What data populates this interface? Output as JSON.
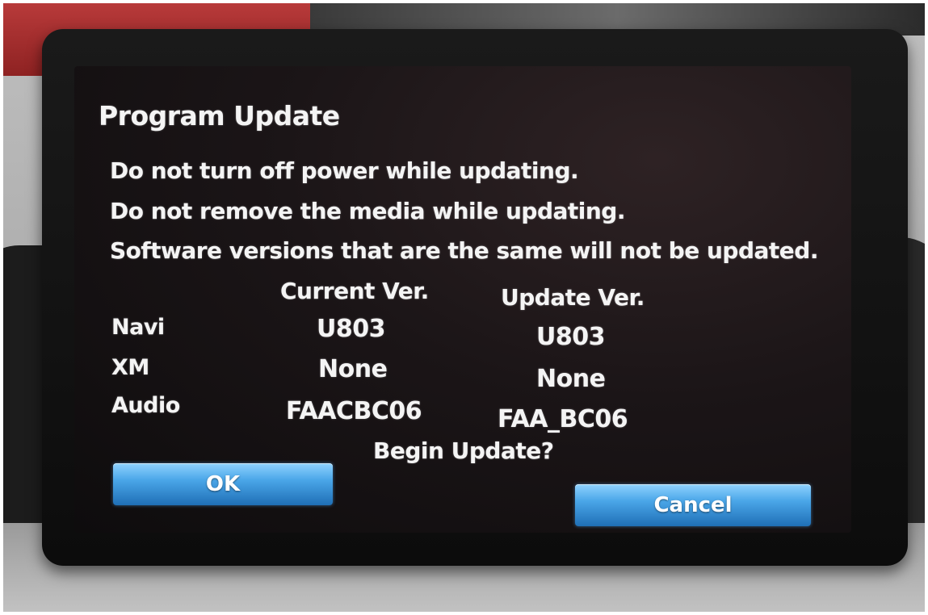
{
  "screen": {
    "title": "Program Update",
    "messages": [
      "Do not turn off power while updating.",
      "Do not remove the media while updating.",
      "Software versions that are the same will not be updated."
    ],
    "columns": {
      "current": "Current Ver.",
      "update": "Update Ver."
    },
    "rows": [
      {
        "label": "Navi",
        "current": "U803",
        "update": "U803"
      },
      {
        "label": "XM",
        "current": "None",
        "update": "None"
      },
      {
        "label": "Audio",
        "current": "FAACBC06",
        "update": "FAA_BC06"
      }
    ],
    "prompt": "Begin Update?",
    "buttons": {
      "ok": "OK",
      "cancel": "Cancel"
    }
  },
  "colors": {
    "button_top": "#8fd2ff",
    "button_bottom": "#1f6fb6",
    "text": "#f4f4f4",
    "screen_bg": "#1b1517"
  }
}
